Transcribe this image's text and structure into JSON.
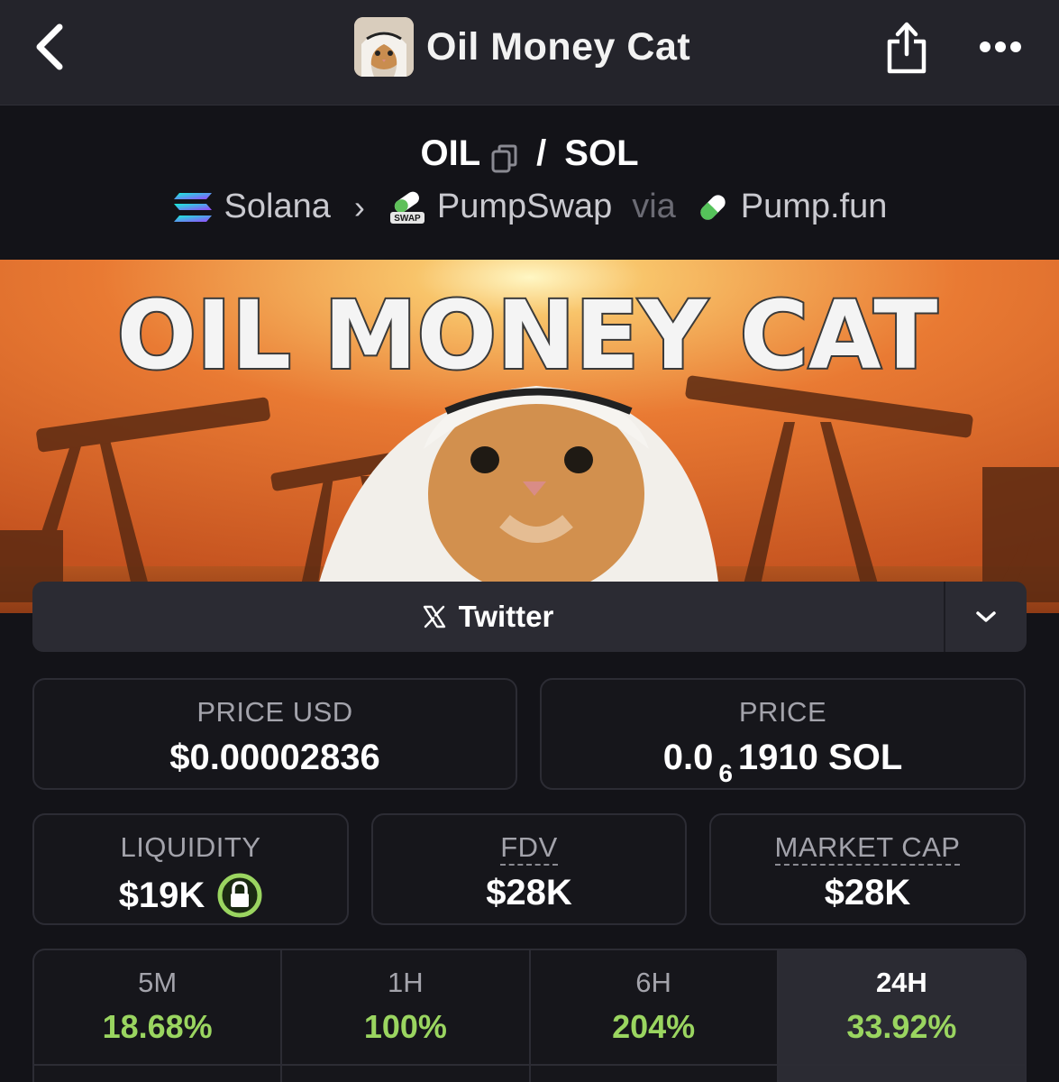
{
  "header": {
    "title": "Oil Money Cat"
  },
  "pair": {
    "base": "OIL",
    "separator": "/",
    "quote": "SOL",
    "chain": "Solana",
    "dex": "PumpSwap",
    "via": "via",
    "launchpad": "Pump.fun",
    "dex_badge": "SWAP"
  },
  "banner": {
    "text": "OIL MONEY CAT"
  },
  "social": {
    "twitter_label": "Twitter"
  },
  "stats": {
    "price_usd_label": "PRICE USD",
    "price_usd": "$0.00002836",
    "price_label": "PRICE",
    "price_prefix": "0.0",
    "price_zeros": "6",
    "price_suffix": "1910 SOL",
    "liquidity_label": "LIQUIDITY",
    "liquidity": "$19K",
    "fdv_label": "FDV",
    "fdv": "$28K",
    "mcap_label": "MARKET CAP",
    "mcap": "$28K"
  },
  "timeframes": [
    {
      "label": "5M",
      "value": "18.68%"
    },
    {
      "label": "1H",
      "value": "100%"
    },
    {
      "label": "6H",
      "value": "204%"
    },
    {
      "label": "24H",
      "value": "33.92%"
    }
  ],
  "colors": {
    "positive": "#9ad560",
    "lock": "#9ad560",
    "background": "#131318",
    "topbar": "#24242b"
  },
  "icons": [
    "back-chevron-icon",
    "share-icon",
    "more-icon",
    "copy-icon",
    "solana-icon",
    "pumpswap-icon",
    "pill-icon",
    "x-icon",
    "chevron-down-icon",
    "lock-icon"
  ]
}
